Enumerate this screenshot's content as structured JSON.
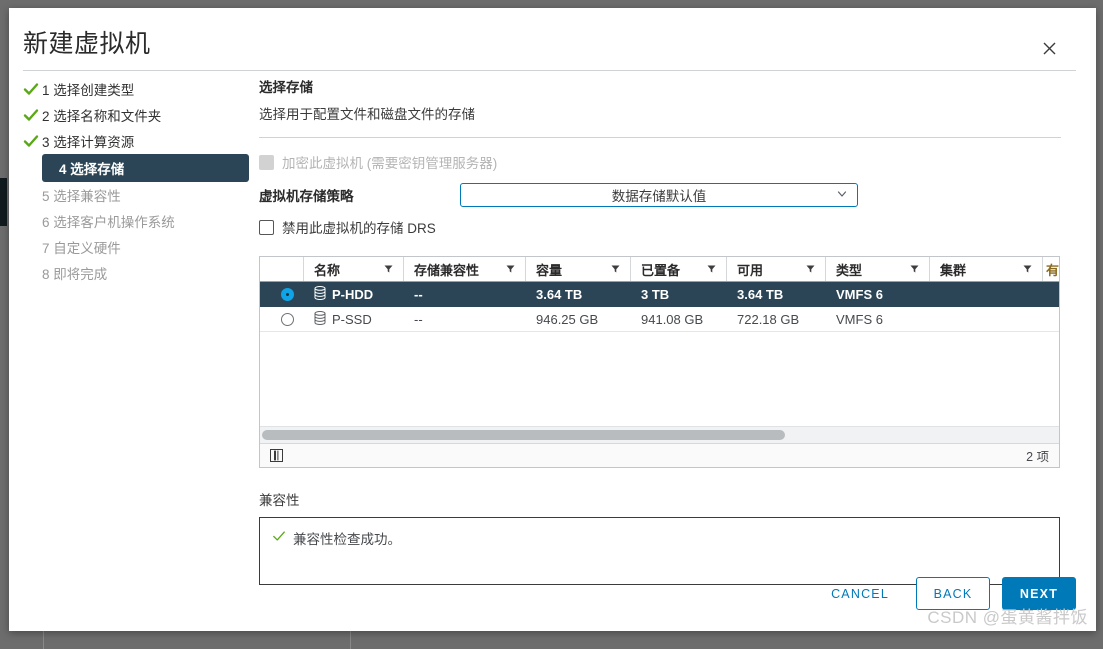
{
  "window": {
    "title": "新建虚拟机",
    "close_icon": "close-icon"
  },
  "steps": [
    {
      "num": "1",
      "label": "1 选择创建类型",
      "state": "done"
    },
    {
      "num": "2",
      "label": "2 选择名称和文件夹",
      "state": "done"
    },
    {
      "num": "3",
      "label": "3 选择计算资源",
      "state": "done"
    },
    {
      "num": "4",
      "label": "4 选择存储",
      "state": "active"
    },
    {
      "num": "5",
      "label": "5 选择兼容性",
      "state": "pending"
    },
    {
      "num": "6",
      "label": "6 选择客户机操作系统",
      "state": "pending"
    },
    {
      "num": "7",
      "label": "7 自定义硬件",
      "state": "pending"
    },
    {
      "num": "8",
      "label": "8 即将完成",
      "state": "pending"
    }
  ],
  "pane": {
    "title": "选择存储",
    "subtitle": "选择用于配置文件和磁盘文件的存储",
    "encrypt_checkbox_label": "加密此虚拟机 (需要密钥管理服务器)",
    "policy_label": "虚拟机存储策略",
    "policy_value": "数据存储默认值",
    "drs_checkbox_label": "禁用此虚拟机的存储 DRS"
  },
  "table": {
    "columns": [
      {
        "key": "select",
        "label": ""
      },
      {
        "key": "name",
        "label": "名称"
      },
      {
        "key": "compat",
        "label": "存储兼容性"
      },
      {
        "key": "capacity",
        "label": "容量"
      },
      {
        "key": "provisioned",
        "label": "已置备"
      },
      {
        "key": "free",
        "label": "可用"
      },
      {
        "key": "type",
        "label": "类型"
      },
      {
        "key": "cluster",
        "label": "集群"
      },
      {
        "key": "truncated",
        "label": "有"
      }
    ],
    "rows": [
      {
        "selected": true,
        "name": "P-HDD",
        "compat": "--",
        "capacity": "3.64 TB",
        "provisioned": "3 TB",
        "free": "3.64 TB",
        "type": "VMFS 6",
        "cluster": ""
      },
      {
        "selected": false,
        "name": "P-SSD",
        "compat": "--",
        "capacity": "946.25 GB",
        "provisioned": "941.08 GB",
        "free": "722.18 GB",
        "type": "VMFS 6",
        "cluster": ""
      }
    ],
    "footer_count": "2 项"
  },
  "compatibility": {
    "label": "兼容性",
    "message": "兼容性检查成功。"
  },
  "footer": {
    "cancel": "CANCEL",
    "back": "BACK",
    "next": "NEXT"
  },
  "watermark": "CSDN @蛋黄酱拌饭",
  "colors": {
    "accent": "#0079b8",
    "selected_row": "#2b4556",
    "success": "#5aa817",
    "radio_on": "#0ea5e8"
  }
}
